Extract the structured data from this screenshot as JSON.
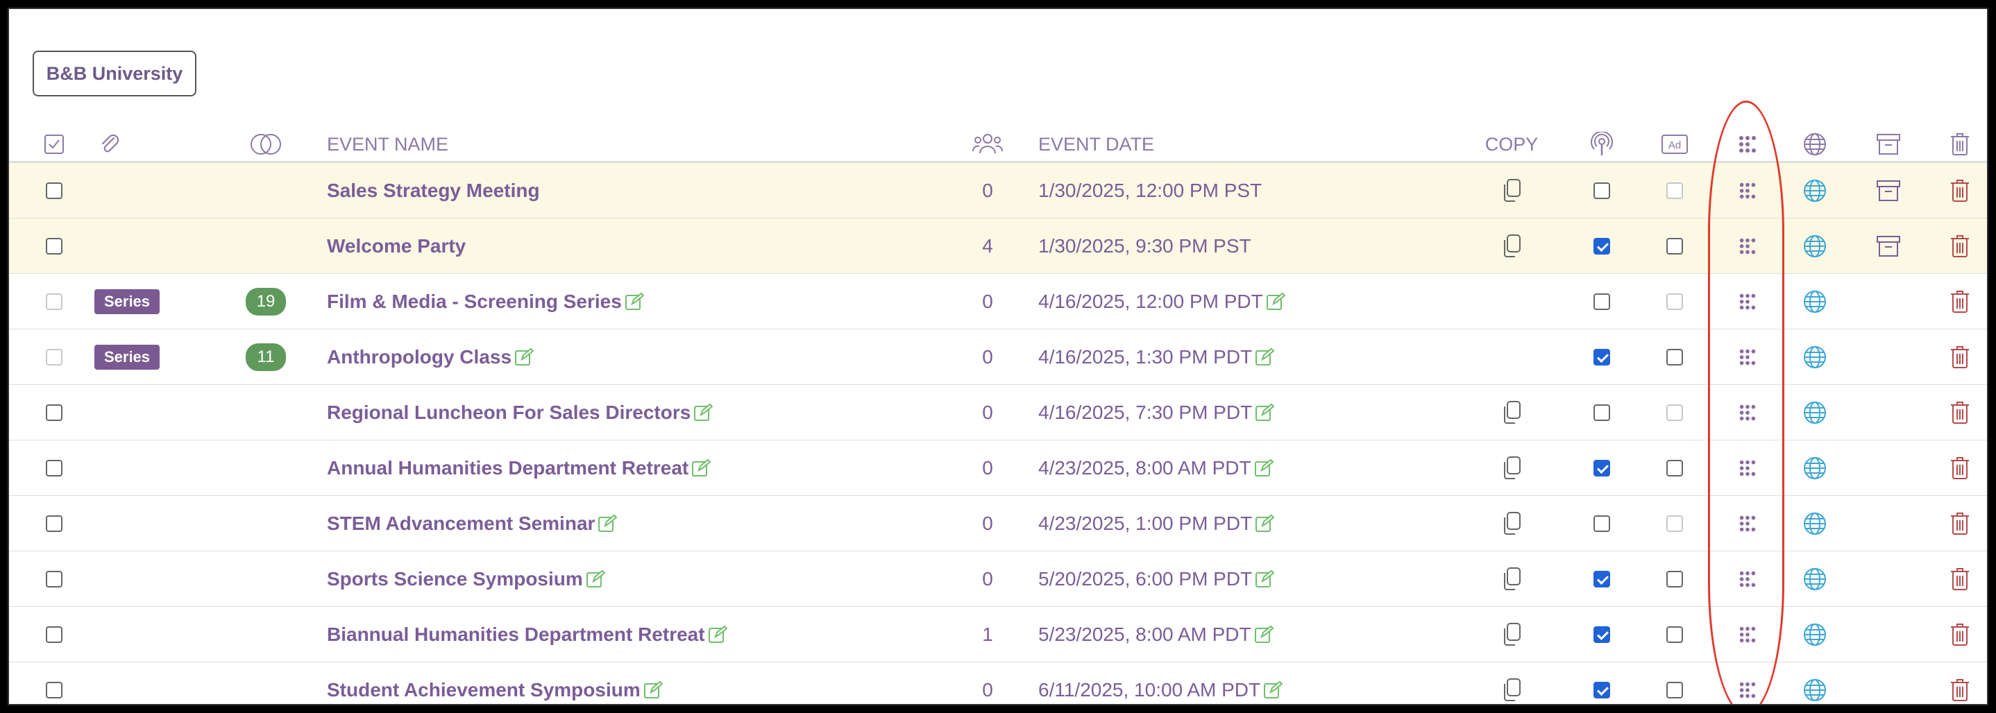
{
  "org_button": {
    "label": "B&B University"
  },
  "header": {
    "event_name": "EVENT NAME",
    "event_date": "EVENT DATE",
    "copy": "COPY"
  },
  "icons": {
    "select_all": "checkbox-icon",
    "attachment": "paperclip-icon",
    "series": "overlapping-circles-icon",
    "attendees": "people-icon",
    "podcast": "podcast-icon",
    "ad": "ad-icon",
    "dots": "dots-grid-icon",
    "globe": "globe-icon",
    "archive": "archive-icon",
    "trash": "trash-icon",
    "copy": "copy-icon",
    "edit": "edit-icon"
  },
  "colors": {
    "accent": "#7b5d98",
    "highlight_row": "#fbf8e4",
    "trash": "#b44a4a",
    "globe": "#3aa6d6",
    "edit": "#6fbf6a",
    "annotation": "#e03a2b"
  },
  "rows": [
    {
      "name": "Sales Strategy Meeting",
      "count": "0",
      "date": "1/30/2025, 12:00 PM PST",
      "series": "",
      "series_count": "",
      "highlight": true,
      "select_disabled": false,
      "has_copy": true,
      "podcast": false,
      "ad_disabled": true,
      "ad": false,
      "archive": true,
      "editable": false
    },
    {
      "name": "Welcome Party",
      "count": "4",
      "date": "1/30/2025, 9:30 PM PST",
      "series": "",
      "series_count": "",
      "highlight": true,
      "select_disabled": false,
      "has_copy": true,
      "podcast": true,
      "ad_disabled": false,
      "ad": false,
      "archive": true,
      "editable": false
    },
    {
      "name": "Film & Media - Screening Series",
      "count": "0",
      "date": "4/16/2025, 12:00 PM PDT",
      "series": "Series",
      "series_count": "19",
      "highlight": false,
      "select_disabled": true,
      "has_copy": false,
      "podcast": false,
      "ad_disabled": true,
      "ad": false,
      "archive": false,
      "editable": true
    },
    {
      "name": "Anthropology Class",
      "count": "0",
      "date": "4/16/2025, 1:30 PM PDT",
      "series": "Series",
      "series_count": "11",
      "highlight": false,
      "select_disabled": true,
      "has_copy": false,
      "podcast": true,
      "ad_disabled": false,
      "ad": false,
      "archive": false,
      "editable": true
    },
    {
      "name": "Regional Luncheon For Sales Directors",
      "count": "0",
      "date": "4/16/2025, 7:30 PM PDT",
      "series": "",
      "series_count": "",
      "highlight": false,
      "select_disabled": false,
      "has_copy": true,
      "podcast": false,
      "ad_disabled": true,
      "ad": false,
      "archive": false,
      "editable": true
    },
    {
      "name": "Annual Humanities Department Retreat",
      "count": "0",
      "date": "4/23/2025, 8:00 AM PDT",
      "series": "",
      "series_count": "",
      "highlight": false,
      "select_disabled": false,
      "has_copy": true,
      "podcast": true,
      "ad_disabled": false,
      "ad": false,
      "archive": false,
      "editable": true
    },
    {
      "name": "STEM Advancement Seminar",
      "count": "0",
      "date": "4/23/2025, 1:00 PM PDT",
      "series": "",
      "series_count": "",
      "highlight": false,
      "select_disabled": false,
      "has_copy": true,
      "podcast": false,
      "ad_disabled": true,
      "ad": false,
      "archive": false,
      "editable": true
    },
    {
      "name": "Sports Science Symposium",
      "count": "0",
      "date": "5/20/2025, 6:00 PM PDT",
      "series": "",
      "series_count": "",
      "highlight": false,
      "select_disabled": false,
      "has_copy": true,
      "podcast": true,
      "ad_disabled": false,
      "ad": false,
      "archive": false,
      "editable": true
    },
    {
      "name": "Biannual Humanities Department Retreat",
      "count": "1",
      "date": "5/23/2025, 8:00 AM PDT",
      "series": "",
      "series_count": "",
      "highlight": false,
      "select_disabled": false,
      "has_copy": true,
      "podcast": true,
      "ad_disabled": false,
      "ad": false,
      "archive": false,
      "editable": true
    },
    {
      "name": "Student Achievement Symposium",
      "count": "0",
      "date": "6/11/2025, 10:00 AM PDT",
      "series": "",
      "series_count": "",
      "highlight": false,
      "select_disabled": false,
      "has_copy": true,
      "podcast": true,
      "ad_disabled": false,
      "ad": false,
      "archive": false,
      "editable": true
    }
  ]
}
